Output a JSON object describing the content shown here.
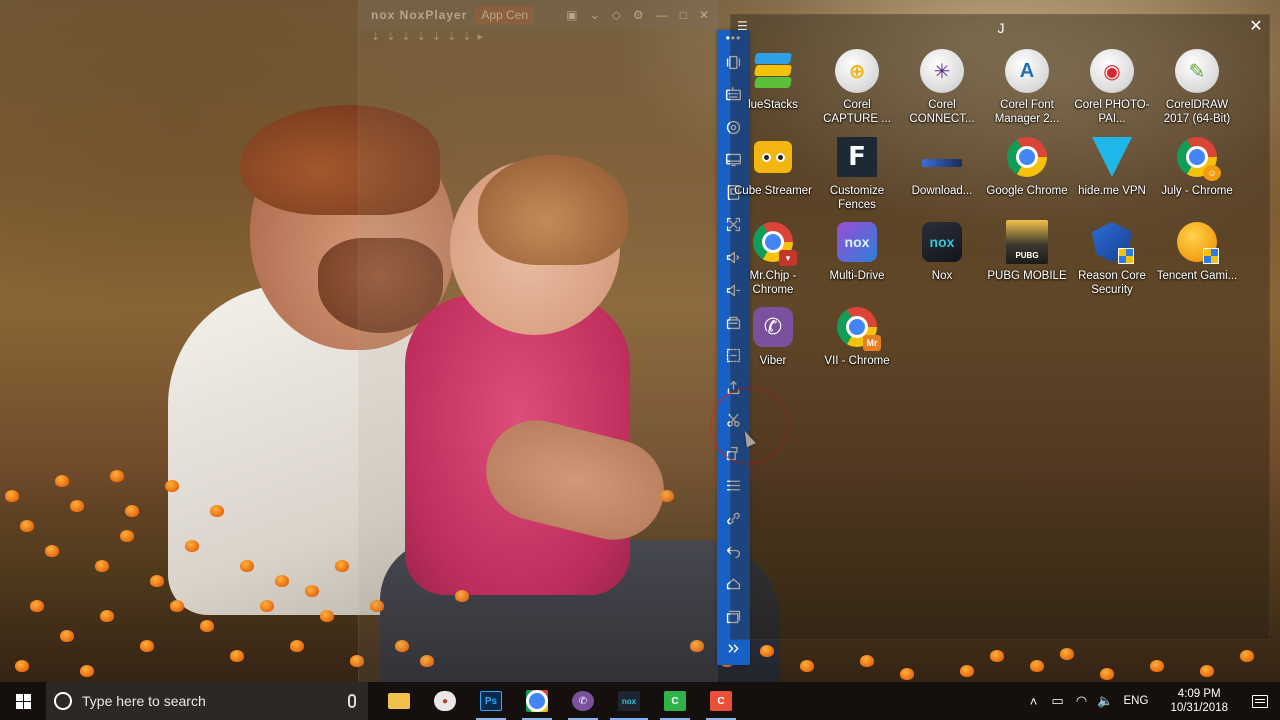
{
  "nox_ghost": {
    "logo": "nox NoxPlayer",
    "tab": "App Cen",
    "controls": [
      "▣",
      "⌄",
      "◇",
      "⚙",
      "—",
      "□",
      "✕"
    ],
    "row2": "⇣⇣⇣⇣⇣⇣⇣▸"
  },
  "toolbar": {
    "items": [
      "more",
      "shake",
      "keyboard",
      "location",
      "display",
      "backup",
      "fullscreen",
      "volume-up",
      "volume-down",
      "apk-install",
      "multi-select",
      "zip",
      "screenshot",
      "rotate",
      "menu",
      "link",
      "back",
      "home",
      "recent",
      "expand"
    ]
  },
  "folder_window": {
    "title": "J",
    "close_label": "✕",
    "menu_label": "☰",
    "items": [
      {
        "label": "lueStacks",
        "icon": "bluestacks-icon"
      },
      {
        "label": "Corel CAPTURE ...",
        "icon": "corel-capture-icon"
      },
      {
        "label": "Corel CONNECT...",
        "icon": "corel-connect-icon"
      },
      {
        "label": "Corel Font Manager 2...",
        "icon": "corel-font-manager-icon"
      },
      {
        "label": "Corel PHOTO-PAI...",
        "icon": "corel-photo-paint-icon"
      },
      {
        "label": "CorelDRAW 2017 (64-Bit)",
        "icon": "coreldraw-icon"
      },
      {
        "label": "Cube Streamer",
        "icon": "cube-streamer-icon"
      },
      {
        "label": "Customize Fences",
        "icon": "fences-icon"
      },
      {
        "label": "Download...",
        "icon": "download-icon"
      },
      {
        "label": "Google Chrome",
        "icon": "chrome-icon"
      },
      {
        "label": "hide.me VPN",
        "icon": "hideme-vpn-icon"
      },
      {
        "label": "July - Chrome",
        "icon": "chrome-profile-icon"
      },
      {
        "label": "Mr.Chjp - Chrome",
        "icon": "chrome-profile-icon"
      },
      {
        "label": "Multi-Drive",
        "icon": "multi-drive-icon"
      },
      {
        "label": "Nox",
        "icon": "nox-icon"
      },
      {
        "label": "PUBG MOBILE",
        "icon": "pubg-icon"
      },
      {
        "label": "Reason Core Security",
        "icon": "reason-core-icon"
      },
      {
        "label": "Tencent Gami...",
        "icon": "tencent-gaming-icon"
      },
      {
        "label": "Viber",
        "icon": "viber-icon"
      },
      {
        "label": "VII - Chrome",
        "icon": "chrome-profile-icon"
      }
    ],
    "icon_text": {
      "multi_drive": "nox",
      "nox": "nox",
      "pubg": "PUBG",
      "mr_badge": "Mr",
      "fences": "F",
      "font_mgr": "A"
    }
  },
  "taskbar": {
    "search_placeholder": "Type here to search",
    "apps": [
      {
        "name": "file-explorer",
        "text": ""
      },
      {
        "name": "cloud-app",
        "text": ""
      },
      {
        "name": "photoshop",
        "text": "Ps"
      },
      {
        "name": "chrome",
        "text": ""
      },
      {
        "name": "viber",
        "text": ""
      },
      {
        "name": "nox",
        "text": "nox"
      },
      {
        "name": "camtasia-green",
        "text": "C"
      },
      {
        "name": "camtasia-red",
        "text": "C"
      }
    ],
    "tray": {
      "chevron": "˄",
      "battery": "▭",
      "wifi": "◠",
      "volume": "🔈",
      "language": "ENG",
      "time": "4:09 PM",
      "date": "10/31/2018"
    }
  },
  "colors": {
    "toolbar_blue": "#1660c6",
    "taskbar": "#120e0c",
    "accent": "#7fb3ff"
  }
}
